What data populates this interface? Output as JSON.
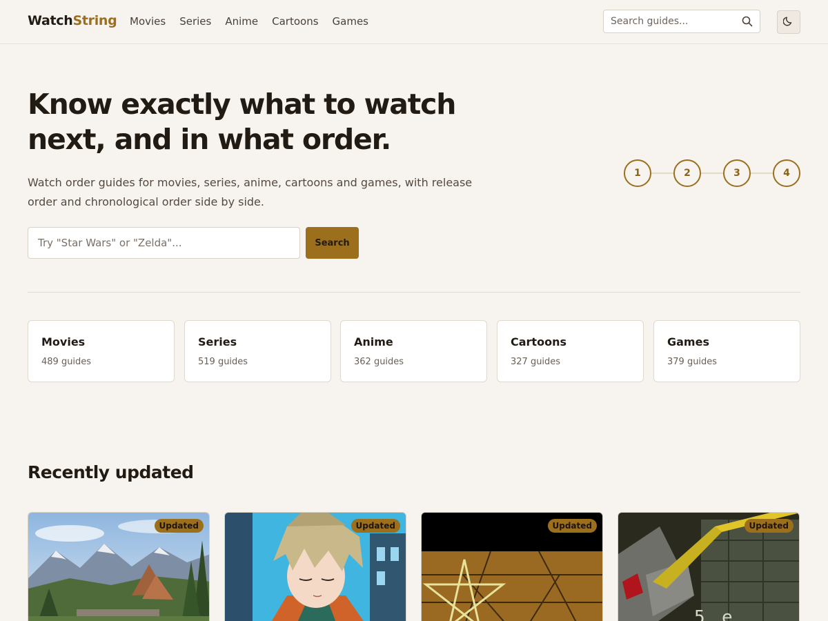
{
  "header": {
    "logo_main": "Watch",
    "logo_accent": "String",
    "nav": [
      "Movies",
      "Series",
      "Anime",
      "Cartoons",
      "Games"
    ],
    "search_placeholder": "Search guides...",
    "search_icon": "search-icon",
    "theme_icon": "moon-icon"
  },
  "hero": {
    "title": "Know exactly what to watch next, and in what order.",
    "subtitle": "Watch order guides for movies, series, anime, cartoons and games, with release order and chronological order side by side.",
    "search_placeholder": "Try \"Star Wars\" or \"Zelda\"...",
    "search_button": "Search",
    "steps": [
      "1",
      "2",
      "3",
      "4"
    ]
  },
  "categories": [
    {
      "name": "Movies",
      "count": "489 guides"
    },
    {
      "name": "Series",
      "count": "519 guides"
    },
    {
      "name": "Anime",
      "count": "362 guides"
    },
    {
      "name": "Cartoons",
      "count": "327 guides"
    },
    {
      "name": "Games",
      "count": "379 guides"
    }
  ],
  "recent": {
    "title": "Recently updated",
    "items": [
      {
        "badge": "Updated"
      },
      {
        "badge": "Updated"
      },
      {
        "badge": "Updated"
      },
      {
        "badge": "Updated"
      }
    ]
  },
  "colors": {
    "accent": "#9c6f1c",
    "background": "#f7f4ef",
    "text": "#221b14"
  }
}
